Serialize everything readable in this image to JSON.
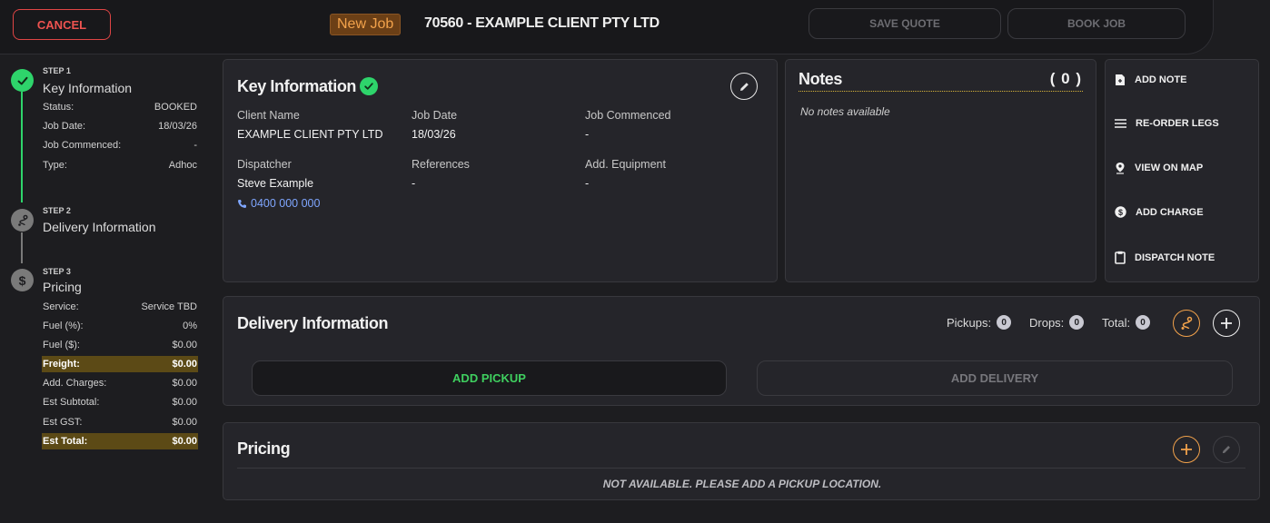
{
  "header": {
    "cancel_label": "CANCEL",
    "job_badge": "New Job",
    "job_title": "70560 - EXAMPLE CLIENT PTY LTD",
    "save_quote_label": "SAVE QUOTE",
    "book_job_label": "BOOK JOB"
  },
  "stepper": {
    "step1": {
      "tag": "STEP 1",
      "title": "Key Information",
      "rows": [
        {
          "label": "Status:",
          "value": "BOOKED"
        },
        {
          "label": "Job Date:",
          "value": "18/03/26"
        },
        {
          "label": "Job Commenced:",
          "value": "-"
        },
        {
          "label": "Type:",
          "value": "Adhoc"
        }
      ]
    },
    "step2": {
      "tag": "STEP 2",
      "title": "Delivery Information"
    },
    "step3": {
      "tag": "STEP 3",
      "title": "Pricing",
      "rows": [
        {
          "label": "Service:",
          "value": "Service TBD"
        },
        {
          "label": "Fuel (%):",
          "value": "0%"
        },
        {
          "label": "Fuel ($):",
          "value": "$0.00"
        },
        {
          "label": "Freight:",
          "value": "$0.00"
        },
        {
          "label": "Add. Charges:",
          "value": "$0.00"
        },
        {
          "label": "Est Subtotal:",
          "value": "$0.00"
        },
        {
          "label": "Est GST:",
          "value": "$0.00"
        },
        {
          "label": "Est Total:",
          "value": "$0.00"
        }
      ]
    }
  },
  "key_info": {
    "title": "Key Information",
    "client_name_label": "Client Name",
    "client_name": "EXAMPLE CLIENT PTY LTD",
    "job_date_label": "Job Date",
    "job_date": "18/03/26",
    "job_commenced_label": "Job Commenced",
    "job_commenced": "-",
    "dispatcher_label": "Dispatcher",
    "dispatcher": "Steve Example",
    "dispatcher_phone": "0400 000 000",
    "references_label": "References",
    "references": "-",
    "add_equipment_label": "Add. Equipment",
    "add_equipment": "-"
  },
  "notes": {
    "title": "Notes",
    "count": "( 0 )",
    "empty_text": "No notes available"
  },
  "side_actions": [
    {
      "label": "ADD NOTE",
      "icon": "add-note-icon"
    },
    {
      "label": "RE-ORDER LEGS",
      "icon": "reorder-icon"
    },
    {
      "label": "VIEW ON MAP",
      "icon": "map-pin-icon"
    },
    {
      "label": "ADD CHARGE",
      "icon": "dollar-icon"
    },
    {
      "label": "DISPATCH NOTE",
      "icon": "clipboard-icon"
    }
  ],
  "delivery": {
    "title": "Delivery Information",
    "pickups_label": "Pickups:",
    "pickups": "0",
    "drops_label": "Drops:",
    "drops": "0",
    "total_label": "Total:",
    "total": "0",
    "add_pickup_label": "ADD PICKUP",
    "add_delivery_label": "ADD DELIVERY"
  },
  "pricing": {
    "title": "Pricing",
    "empty_text": "NOT AVAILABLE. PLEASE ADD A PICKUP LOCATION."
  },
  "colors": {
    "accent_orange": "#f2a24b",
    "success_green": "#2ed46b",
    "danger_red": "#ef5350",
    "link_blue": "#7fa6ff",
    "highlight": "#5c4a16"
  }
}
